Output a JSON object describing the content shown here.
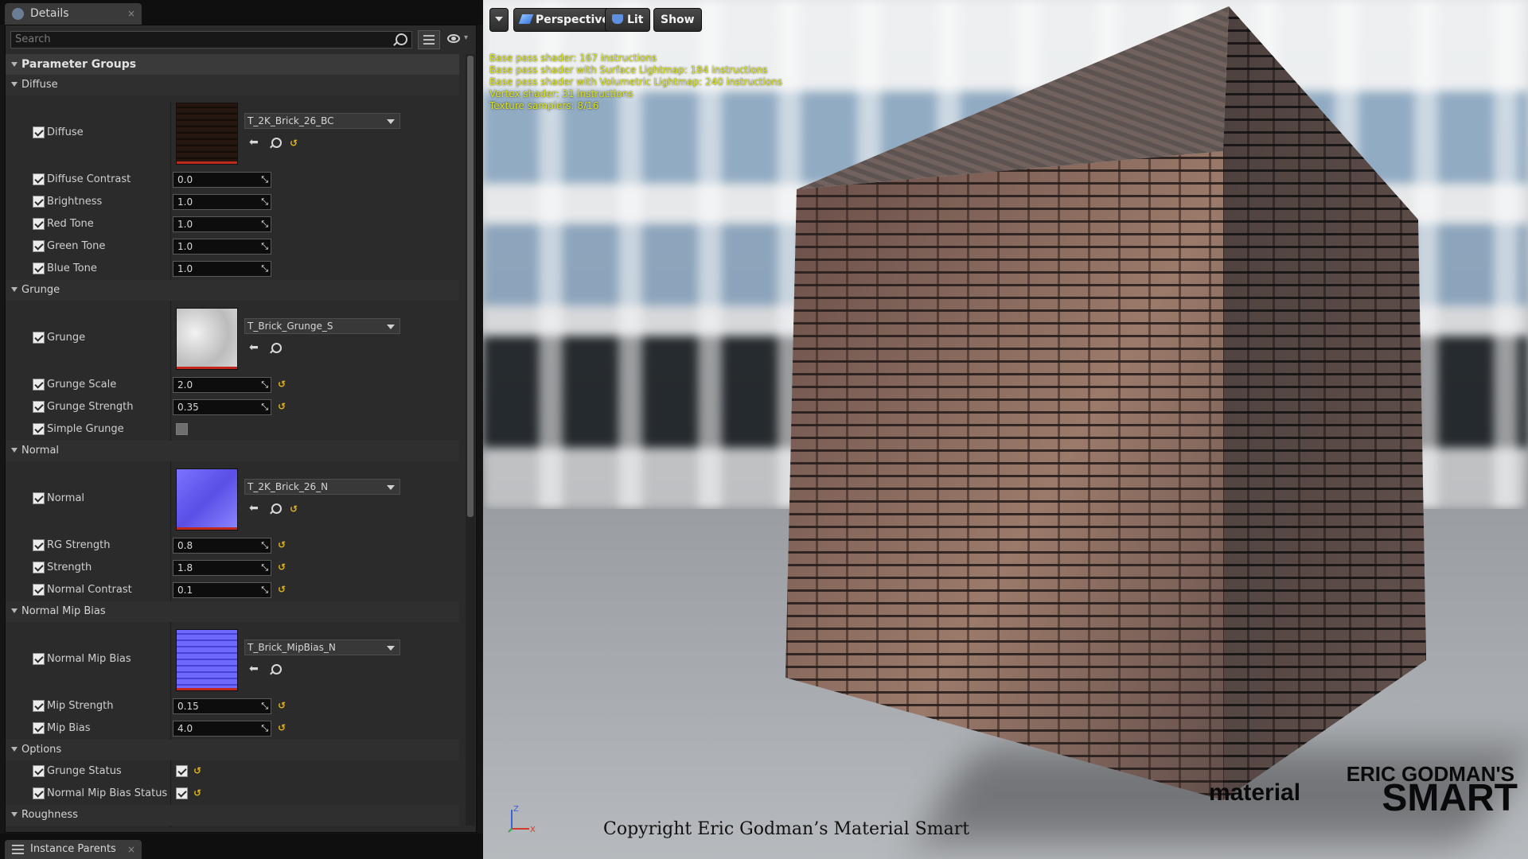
{
  "details_panel": {
    "tab_label": "Details",
    "close_glyph": "×",
    "search_placeholder": "Search",
    "eye_caret": "▾",
    "parameter_groups_label": "Parameter Groups",
    "groups": [
      {
        "label": "Diffuse"
      },
      {
        "label": "Grunge"
      },
      {
        "label": "Normal"
      },
      {
        "label": "Normal Mip Bias"
      },
      {
        "label": "Options"
      },
      {
        "label": "Roughness"
      }
    ],
    "params": {
      "diffuse": {
        "label": "Diffuse",
        "asset": "T_2K_Brick_26_BC"
      },
      "diffuse_contrast": {
        "label": "Diffuse Contrast",
        "value": "0.0"
      },
      "brightness": {
        "label": "Brightness",
        "value": "1.0"
      },
      "red_tone": {
        "label": "Red Tone",
        "value": "1.0"
      },
      "green_tone": {
        "label": "Green Tone",
        "value": "1.0"
      },
      "blue_tone": {
        "label": "Blue Tone",
        "value": "1.0"
      },
      "grunge": {
        "label": "Grunge",
        "asset": "T_Brick_Grunge_S"
      },
      "grunge_scale": {
        "label": "Grunge Scale",
        "value": "2.0"
      },
      "grunge_strength": {
        "label": "Grunge Strength",
        "value": "0.35"
      },
      "simple_grunge": {
        "label": "Simple Grunge",
        "checked": false
      },
      "normal": {
        "label": "Normal",
        "asset": "T_2K_Brick_26_N"
      },
      "rg_strength": {
        "label": "RG Strength",
        "value": "0.8"
      },
      "strength": {
        "label": "Strength",
        "value": "1.8"
      },
      "normal_contrast": {
        "label": "Normal Contrast",
        "value": "0.1"
      },
      "normal_mip_bias": {
        "label": "Normal Mip Bias",
        "asset": "T_Brick_MipBias_N"
      },
      "mip_strength": {
        "label": "Mip Strength",
        "value": "0.15"
      },
      "mip_bias": {
        "label": "Mip Bias",
        "value": "4.0"
      },
      "grunge_status": {
        "label": "Grunge Status",
        "checked": true
      },
      "normal_mip_bias_status": {
        "label": "Normal Mip Bias Status",
        "checked": true
      }
    },
    "icons": {
      "drag": "⤡",
      "reset": "↺",
      "use_selected": "⬅"
    }
  },
  "bottom_tab": {
    "label": "Instance Parents",
    "close_glyph": "×"
  },
  "viewport": {
    "toolbar": {
      "perspective_label": "Perspective",
      "lit_label": "Lit",
      "show_label": "Show"
    },
    "stats": [
      "Base pass shader: 167 instructions",
      "Base pass shader with Surface Lightmap: 184 instructions",
      "Base pass shader with Volumetric Lightmap: 240 instructions",
      "Vertex shader: 31 instructions",
      "Texture samplers: 8/16"
    ],
    "axis": {
      "z": "Z",
      "x": "X"
    },
    "copyright": "Copyright Eric Godman’s Material Smart",
    "logo": {
      "line1": "ERIC GODMAN'S",
      "line2": "material",
      "line3": "SMART"
    },
    "colors": {
      "stats_text": "#d8e31a",
      "reset_icon": "#e0b321",
      "normal_texture": "#6a60ff"
    }
  }
}
